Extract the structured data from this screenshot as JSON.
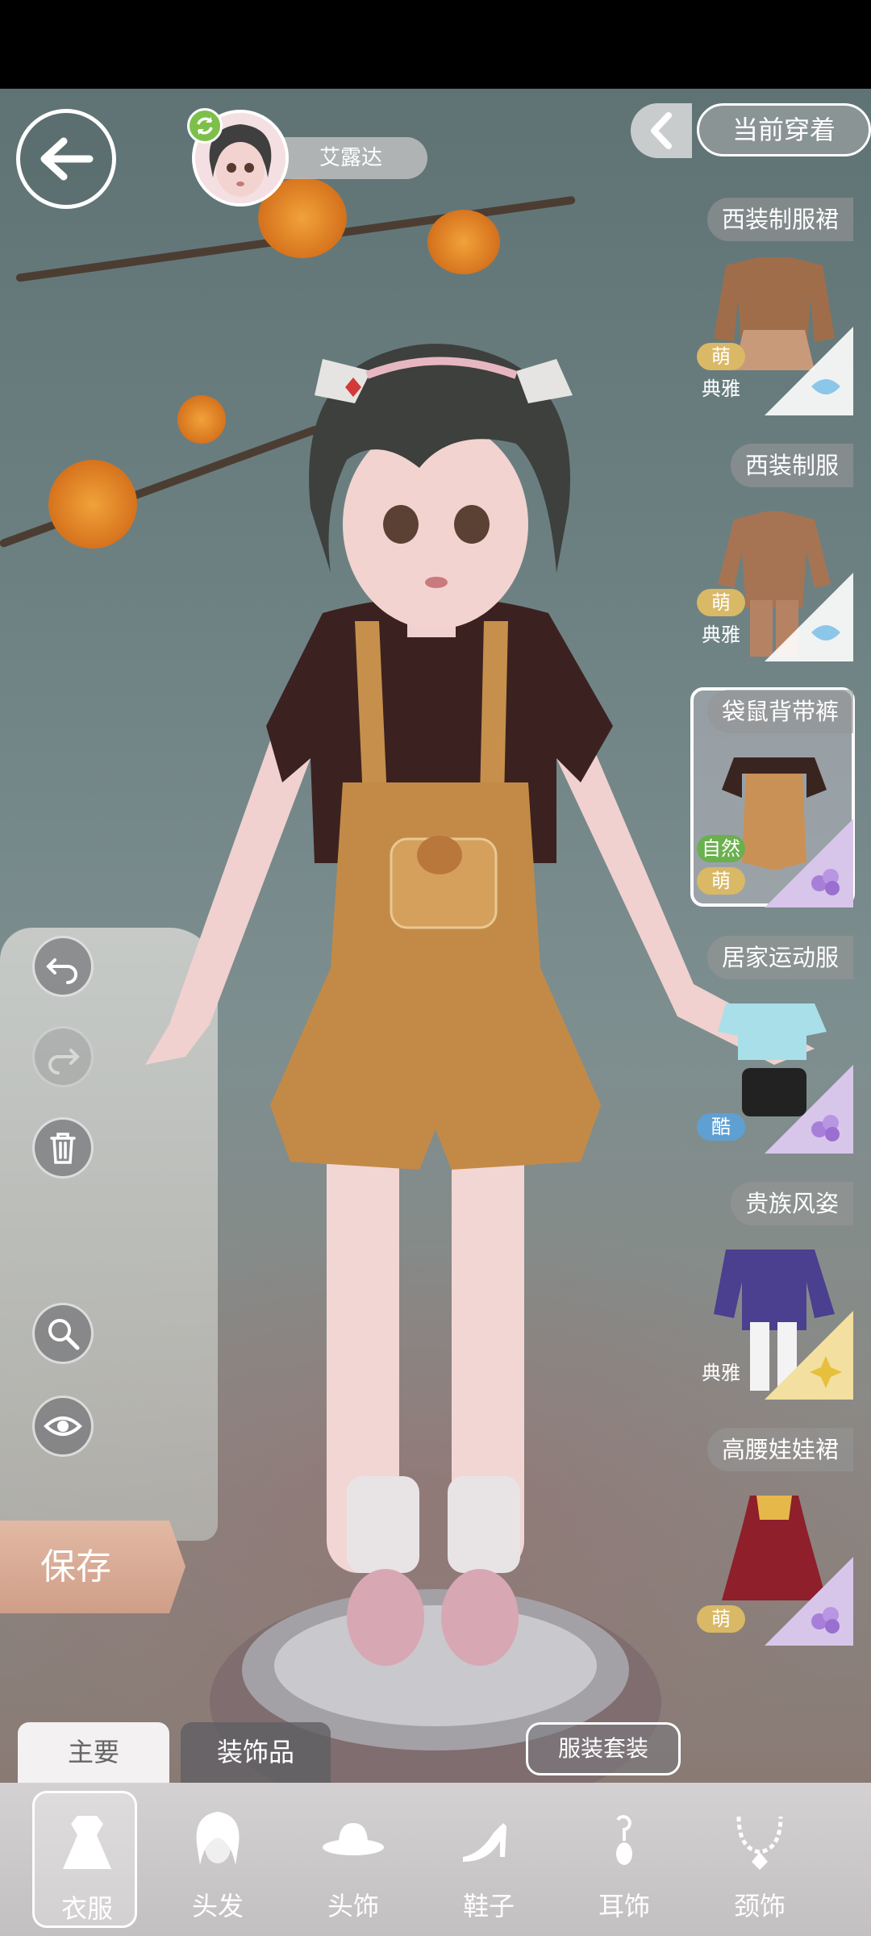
{
  "character": {
    "name": "艾露达"
  },
  "header": {
    "current_wearing_label": "当前穿着"
  },
  "outfits": [
    {
      "name": "西装制服裙",
      "tags": [
        "萌",
        "典雅"
      ],
      "corner": "blue"
    },
    {
      "name": "西装制服",
      "tags": [
        "萌",
        "典雅"
      ],
      "corner": "blue"
    },
    {
      "name": "袋鼠背带裤",
      "tags": [
        "自然",
        "萌"
      ],
      "corner": "purple",
      "selected": true
    },
    {
      "name": "居家运动服",
      "tags": [
        "酷"
      ],
      "corner": "purple"
    },
    {
      "name": "贵族风姿",
      "tags": [
        "典雅"
      ],
      "corner": "yellow"
    },
    {
      "name": "高腰娃娃裙",
      "tags": [
        "萌"
      ],
      "corner": "purple"
    }
  ],
  "actions": {
    "save_label": "保存",
    "outfit_set_label": "服装套装"
  },
  "tabs": {
    "main_label": "主要",
    "accessories_label": "装饰品"
  },
  "categories": [
    {
      "label": "衣服",
      "icon": "dress-icon",
      "active": true
    },
    {
      "label": "头发",
      "icon": "hair-icon"
    },
    {
      "label": "头饰",
      "icon": "hat-icon"
    },
    {
      "label": "鞋子",
      "icon": "shoe-icon"
    },
    {
      "label": "耳饰",
      "icon": "earring-icon"
    },
    {
      "label": "颈饰",
      "icon": "necklace-icon"
    }
  ]
}
